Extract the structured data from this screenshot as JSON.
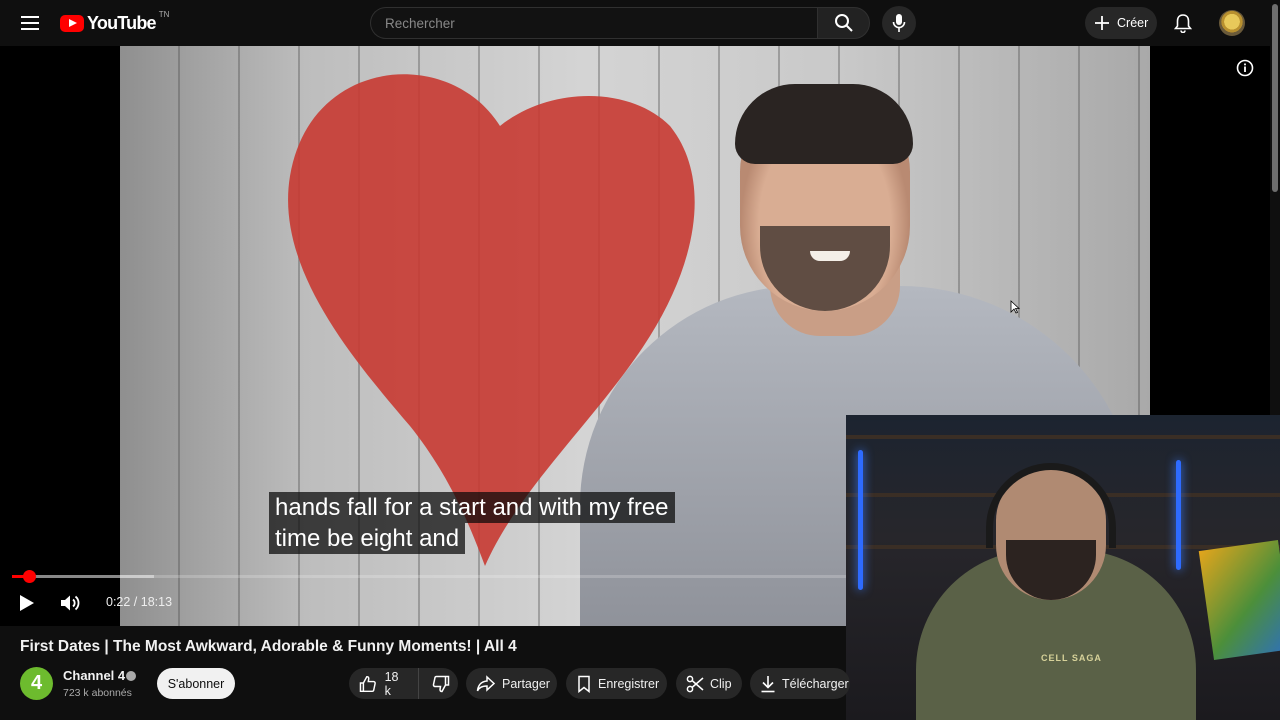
{
  "header": {
    "logo_text": "YouTube",
    "region_code": "TN",
    "search_placeholder": "Rechercher",
    "create_label": "Créer"
  },
  "player": {
    "captions": [
      "hands fall for a start and with my free",
      "time be eight and"
    ],
    "current_time": "0:22",
    "duration": "18:13",
    "time_display": "0:22 / 18:13",
    "progress_fraction": 0.0201,
    "buffered_fraction": 0.17
  },
  "webcam": {
    "shirt_text": "CELL SAGA"
  },
  "video": {
    "title": "First Dates | The Most Awkward, Adorable & Funny Moments! | All 4"
  },
  "channel": {
    "name": "Channel 4",
    "avatar_text": "4",
    "subscribers": "723 k abonnés",
    "subscribe_label": "S'abonner"
  },
  "actions": {
    "like_count": "18 k",
    "share_label": "Partager",
    "save_label": "Enregistrer",
    "clip_label": "Clip",
    "download_label": "Télécharger"
  },
  "colors": {
    "accent": "#ff0000",
    "background": "#0f0f0f",
    "pill": "#272727"
  }
}
